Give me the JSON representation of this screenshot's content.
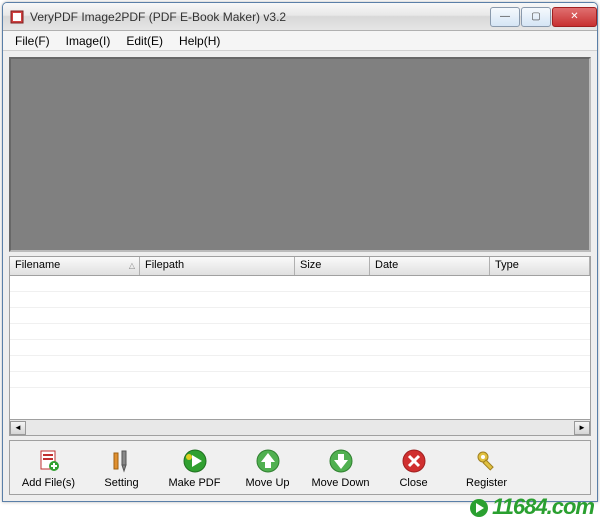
{
  "window": {
    "title": "VeryPDF Image2PDF (PDF E-Book Maker) v3.2"
  },
  "menu": {
    "file": "File(F)",
    "image": "Image(I)",
    "edit": "Edit(E)",
    "help": "Help(H)"
  },
  "columns": {
    "filename": "Filename",
    "filepath": "Filepath",
    "size": "Size",
    "date": "Date",
    "type": "Type"
  },
  "toolbar": {
    "add": "Add File(s)",
    "setting": "Setting",
    "make": "Make PDF",
    "moveup": "Move Up",
    "movedown": "Move Down",
    "close": "Close",
    "register": "Register"
  },
  "watermark": "11684.com"
}
